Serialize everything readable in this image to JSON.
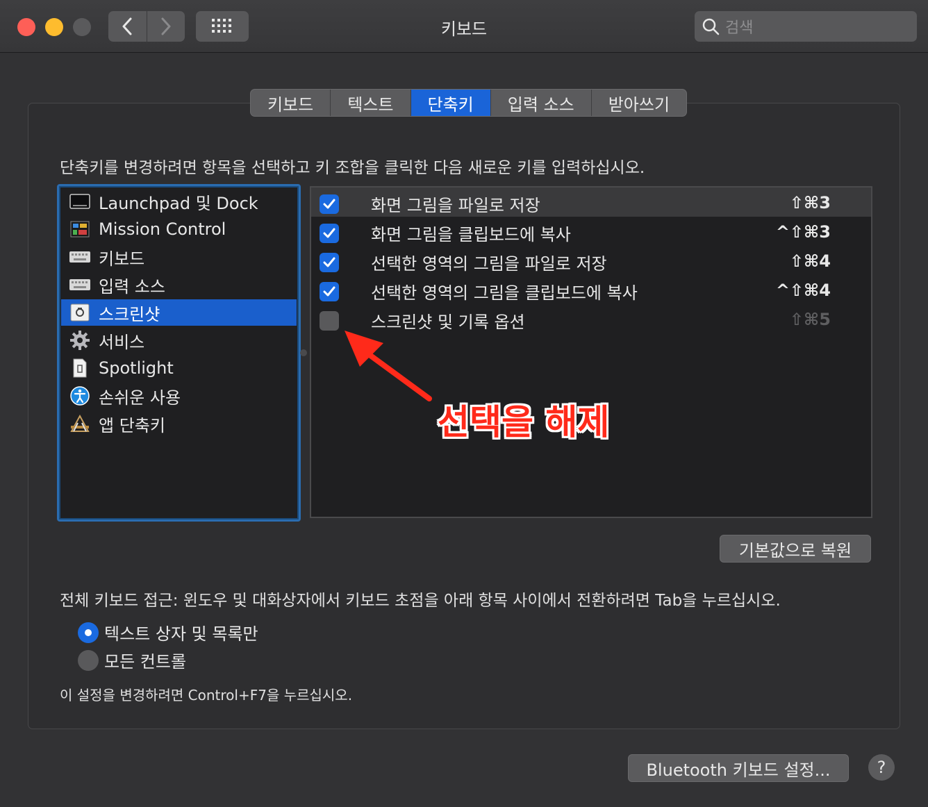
{
  "window": {
    "title": "키보드"
  },
  "search": {
    "placeholder": "검색"
  },
  "tabs": [
    {
      "label": "키보드",
      "active": false
    },
    {
      "label": "텍스트",
      "active": false
    },
    {
      "label": "단축키",
      "active": true
    },
    {
      "label": "입력 소스",
      "active": false
    },
    {
      "label": "받아쓰기",
      "active": false
    }
  ],
  "instruction": "단축키를 변경하려면 항목을 선택하고 키 조합을 클릭한 다음 새로운 키를 입력하십시오.",
  "categories": [
    {
      "label": "Launchpad 및 Dock",
      "icon": "launchpad-icon"
    },
    {
      "label": "Mission Control",
      "icon": "mission-control-icon"
    },
    {
      "label": "키보드",
      "icon": "keyboard-icon"
    },
    {
      "label": "입력 소스",
      "icon": "keyboard-icon"
    },
    {
      "label": "스크린샷",
      "icon": "screenshot-icon",
      "selected": true
    },
    {
      "label": "서비스",
      "icon": "gear-icon"
    },
    {
      "label": "Spotlight",
      "icon": "spotlight-icon"
    },
    {
      "label": "손쉬운 사용",
      "icon": "accessibility-icon"
    },
    {
      "label": "앱 단축키",
      "icon": "app-shortcuts-icon"
    }
  ],
  "shortcuts": [
    {
      "label": "화면 그림을 파일로 저장",
      "keys": "⇧⌘3",
      "checked": true
    },
    {
      "label": "화면 그림을 클립보드에 복사",
      "keys": "^⇧⌘3",
      "checked": true
    },
    {
      "label": "선택한 영역의 그림을 파일로 저장",
      "keys": "⇧⌘4",
      "checked": true
    },
    {
      "label": "선택한 영역의 그림을 클립보드에 복사",
      "keys": "^⇧⌘4",
      "checked": true
    },
    {
      "label": "스크린샷 및 기록 옵션",
      "keys": "⇧⌘5",
      "checked": false
    }
  ],
  "annotation": "선택을 해제",
  "restore_button": "기본값으로 복원",
  "full_keyboard": {
    "description": "전체 키보드 접근: 윈도우 및 대화상자에서 키보드 초점을 아래 항목 사이에서 전환하려면 Tab을 누르십시오.",
    "options": [
      {
        "label": "텍스트 상자 및 목록만",
        "selected": true
      },
      {
        "label": "모든 컨트롤",
        "selected": false
      }
    ],
    "hint": "이 설정을 변경하려면 Control+F7을 누르십시오."
  },
  "bluetooth_button": "Bluetooth 키보드 설정...",
  "help_button": "?",
  "colors": {
    "accent": "#1a64d8",
    "annotation": "#ff2a1a"
  }
}
